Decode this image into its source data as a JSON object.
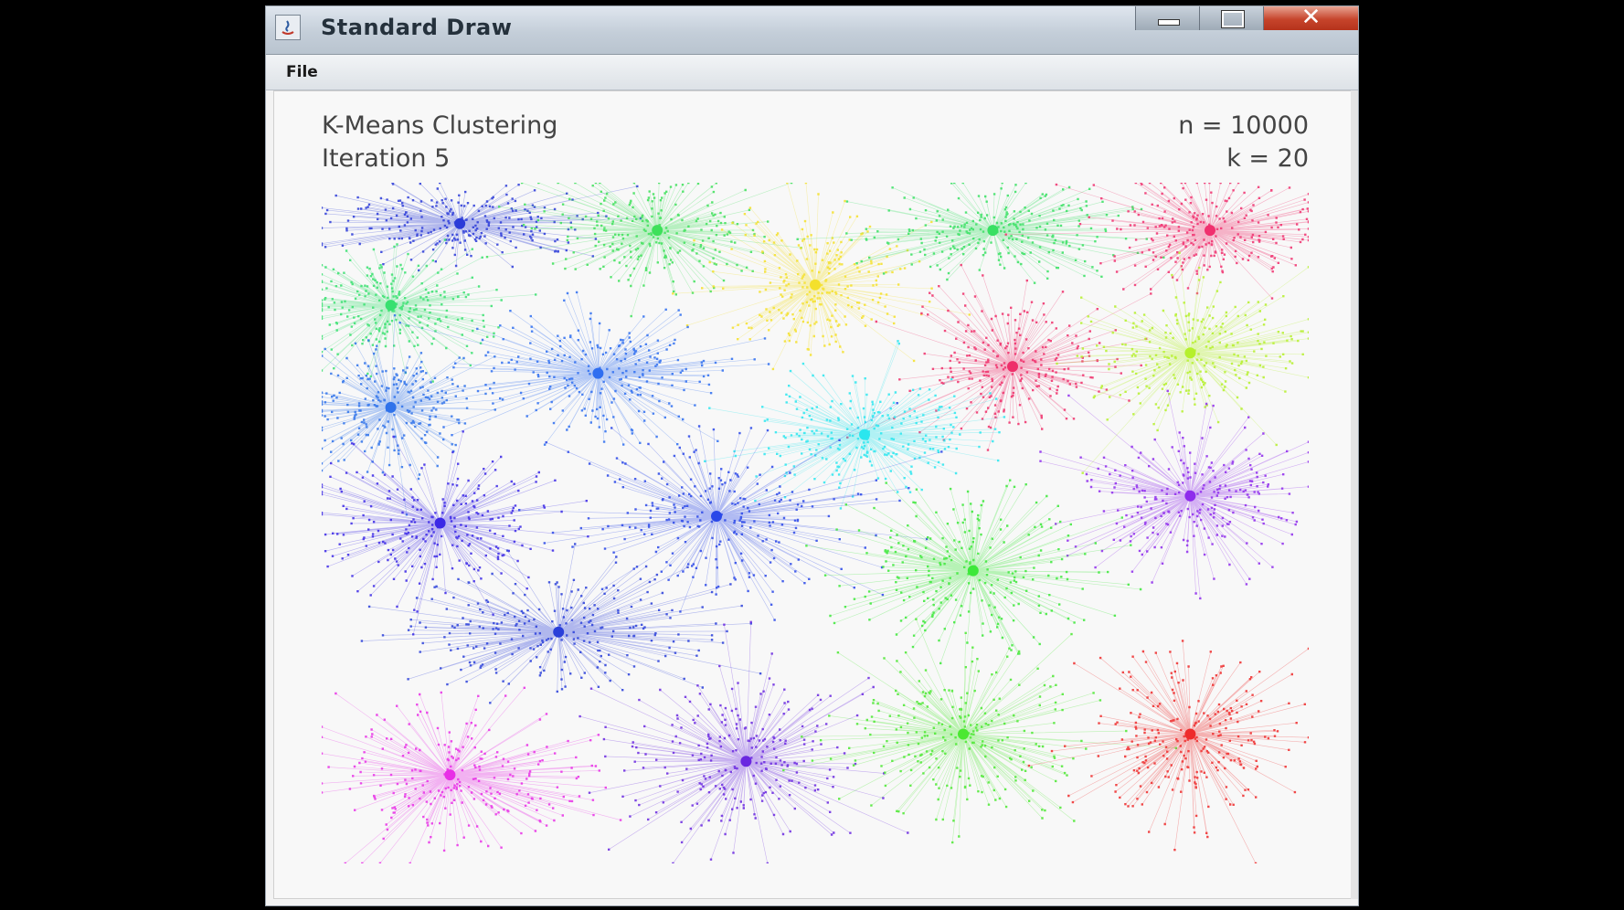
{
  "window": {
    "title": "Standard Draw",
    "close_glyph": "✕"
  },
  "menu": {
    "file": "File"
  },
  "canvas": {
    "title": "K-Means Clustering",
    "iteration": "Iteration 5",
    "n_label": "n = 10000",
    "k_label": "k = 20"
  },
  "colors": {
    "titlebar": "#c4ced9",
    "close": "#c6442b",
    "canvas_bg": "#f8f8f8"
  },
  "chart_data": {
    "type": "scatter",
    "xlim": [
      0,
      1
    ],
    "ylim": [
      0,
      1
    ],
    "grid": false,
    "n_points": 10000,
    "k": 20,
    "clusters": [
      {
        "center": [
          0.14,
          0.06
        ],
        "color": "#2b3bd8",
        "spread": [
          0.12,
          0.05
        ]
      },
      {
        "center": [
          0.34,
          0.07
        ],
        "color": "#3ee05a",
        "spread": [
          0.11,
          0.07
        ]
      },
      {
        "center": [
          0.5,
          0.15
        ],
        "color": "#f4e02c",
        "spread": [
          0.09,
          0.1
        ]
      },
      {
        "center": [
          0.68,
          0.07
        ],
        "color": "#38e063",
        "spread": [
          0.12,
          0.06
        ]
      },
      {
        "center": [
          0.9,
          0.07
        ],
        "color": "#f0306e",
        "spread": [
          0.1,
          0.07
        ]
      },
      {
        "center": [
          0.07,
          0.18
        ],
        "color": "#38e070",
        "spread": [
          0.09,
          0.07
        ]
      },
      {
        "center": [
          0.28,
          0.28
        ],
        "color": "#2f6ef0",
        "spread": [
          0.11,
          0.09
        ]
      },
      {
        "center": [
          0.7,
          0.27
        ],
        "color": "#ee2f6a",
        "spread": [
          0.09,
          0.09
        ]
      },
      {
        "center": [
          0.88,
          0.25
        ],
        "color": "#b5f02c",
        "spread": [
          0.1,
          0.09
        ]
      },
      {
        "center": [
          0.07,
          0.33
        ],
        "color": "#2f72ea",
        "spread": [
          0.08,
          0.08
        ]
      },
      {
        "center": [
          0.55,
          0.37
        ],
        "color": "#2be6ee",
        "spread": [
          0.1,
          0.08
        ]
      },
      {
        "center": [
          0.12,
          0.5
        ],
        "color": "#3b28e6",
        "spread": [
          0.12,
          0.09
        ]
      },
      {
        "center": [
          0.4,
          0.49
        ],
        "color": "#2a48e8",
        "spread": [
          0.13,
          0.1
        ]
      },
      {
        "center": [
          0.88,
          0.46
        ],
        "color": "#8e2cec",
        "spread": [
          0.1,
          0.1
        ]
      },
      {
        "center": [
          0.66,
          0.57
        ],
        "color": "#3ce83a",
        "spread": [
          0.12,
          0.1
        ]
      },
      {
        "center": [
          0.24,
          0.66
        ],
        "color": "#2a3fd9",
        "spread": [
          0.15,
          0.08
        ]
      },
      {
        "center": [
          0.13,
          0.87
        ],
        "color": "#e82fe6",
        "spread": [
          0.13,
          0.09
        ]
      },
      {
        "center": [
          0.43,
          0.85
        ],
        "color": "#6a28e0",
        "spread": [
          0.12,
          0.11
        ]
      },
      {
        "center": [
          0.65,
          0.81
        ],
        "color": "#4ce832",
        "spread": [
          0.11,
          0.11
        ]
      },
      {
        "center": [
          0.88,
          0.81
        ],
        "color": "#ee2c2c",
        "spread": [
          0.1,
          0.11
        ]
      }
    ]
  }
}
